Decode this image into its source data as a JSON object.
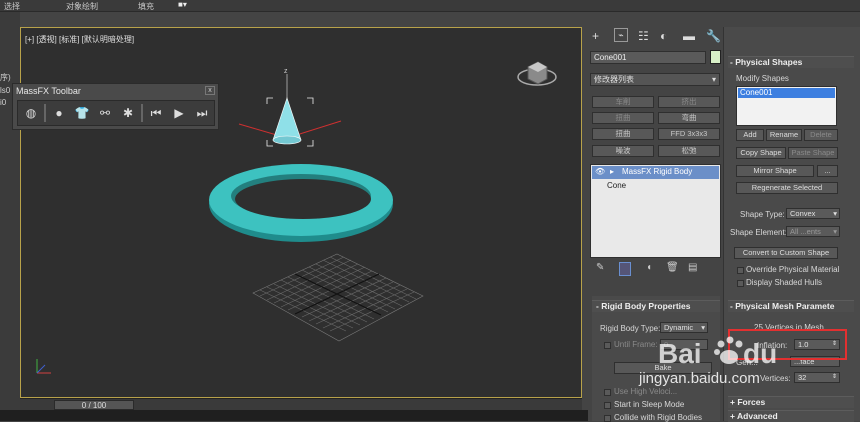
{
  "menubar": {
    "items": [
      "选择",
      "对象绘制",
      "填充"
    ]
  },
  "left_strip": {
    "items": [
      "序)",
      "ls0",
      "i0"
    ]
  },
  "viewport": {
    "label": "[+] [透视] [标准] [默认明暗处理]"
  },
  "massfx_toolbar": {
    "title": "MassFX Toolbar",
    "close": "x"
  },
  "timeline": {
    "frame": "0 / 100"
  },
  "command_panel": {
    "object_name": "Cone001",
    "modifier_list": "修改器列表",
    "modifier_buttons": [
      "车削",
      "挤出",
      "弯曲",
      "扭曲",
      "扭曲",
      "FFD 3x3x3",
      "噪波",
      "松弛"
    ],
    "stack": {
      "selected": "MassFX Rigid Body",
      "base": "Cone"
    }
  },
  "rigid_body": {
    "header": "Rigid Body Properties",
    "type_label": "Rigid Body Type:",
    "type_value": "Dynamic",
    "until_frame_label": "Until Frame:",
    "until_frame_value": "0",
    "bake_label": "Bake",
    "use_high_label": "Use High Veloci...",
    "sleep_label": "Start in Sleep Mode",
    "collide_label": "Collide with Rigid Bodies"
  },
  "physical_shapes": {
    "header": "Physical Shapes",
    "modify_label": "Modify Shapes",
    "list_item": "Cone001",
    "add": "Add",
    "rename": "Rename",
    "delete": "Delete",
    "copy": "Copy Shape",
    "paste": "Paste Shape",
    "mirror": "Mirror Shape",
    "dots": "...",
    "regen": "Regenerate Selected",
    "shape_type_label": "Shape Type:",
    "shape_type_value": "Convex",
    "shape_element_label": "Shape Element:",
    "shape_element_value": "All ...ents",
    "convert": "Convert to Custom Shape",
    "override": "Override Physical Material",
    "display_hulls": "Display Shaded Hulls"
  },
  "mesh_params": {
    "header": "Physical Mesh Paramete",
    "vertices_info": "25 Vertices in Mesh",
    "inflation_label": "Inflation:",
    "inflation_value": "1.0",
    "generate_label": "Gen...",
    "surface_label": "...face",
    "vertices_label": "Vertices:",
    "vertices_value": "32",
    "forces": "Forces",
    "advanced": "Advanced"
  },
  "watermark": {
    "brand": "Bai du",
    "site": "jingyan.baidu.com"
  },
  "colors": {
    "accent": "#3fbfbf",
    "highlight": "#e23030",
    "selection": "#3d7fe0"
  }
}
